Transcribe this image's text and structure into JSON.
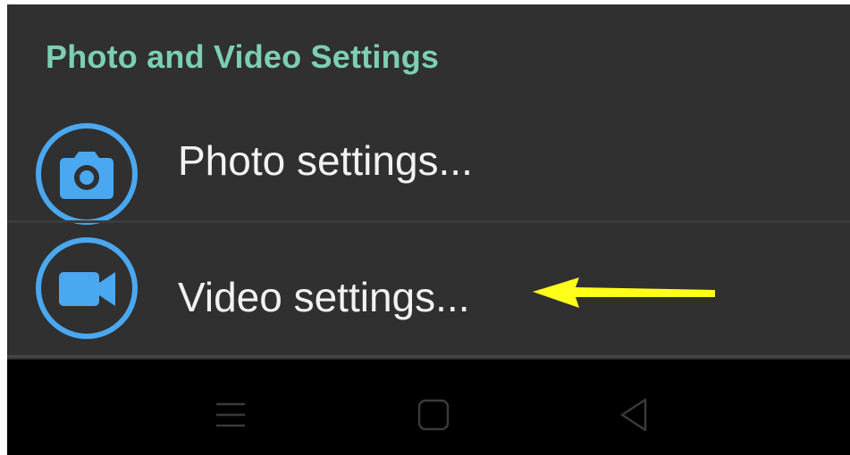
{
  "section": {
    "header": "Photo and Video Settings"
  },
  "items": [
    {
      "label": "Photo settings...",
      "icon": "camera-icon"
    },
    {
      "label": "Video settings...",
      "icon": "video-camera-icon"
    }
  ],
  "annotation": {
    "icon": "yellow-arrow-left",
    "color": "#ffff1a"
  },
  "navbar": {
    "buttons": [
      "menu-icon",
      "home-icon",
      "back-icon"
    ]
  },
  "colors": {
    "accent": "#7ccfb2",
    "icon_blue": "#4aa8f0",
    "background": "#303030"
  }
}
